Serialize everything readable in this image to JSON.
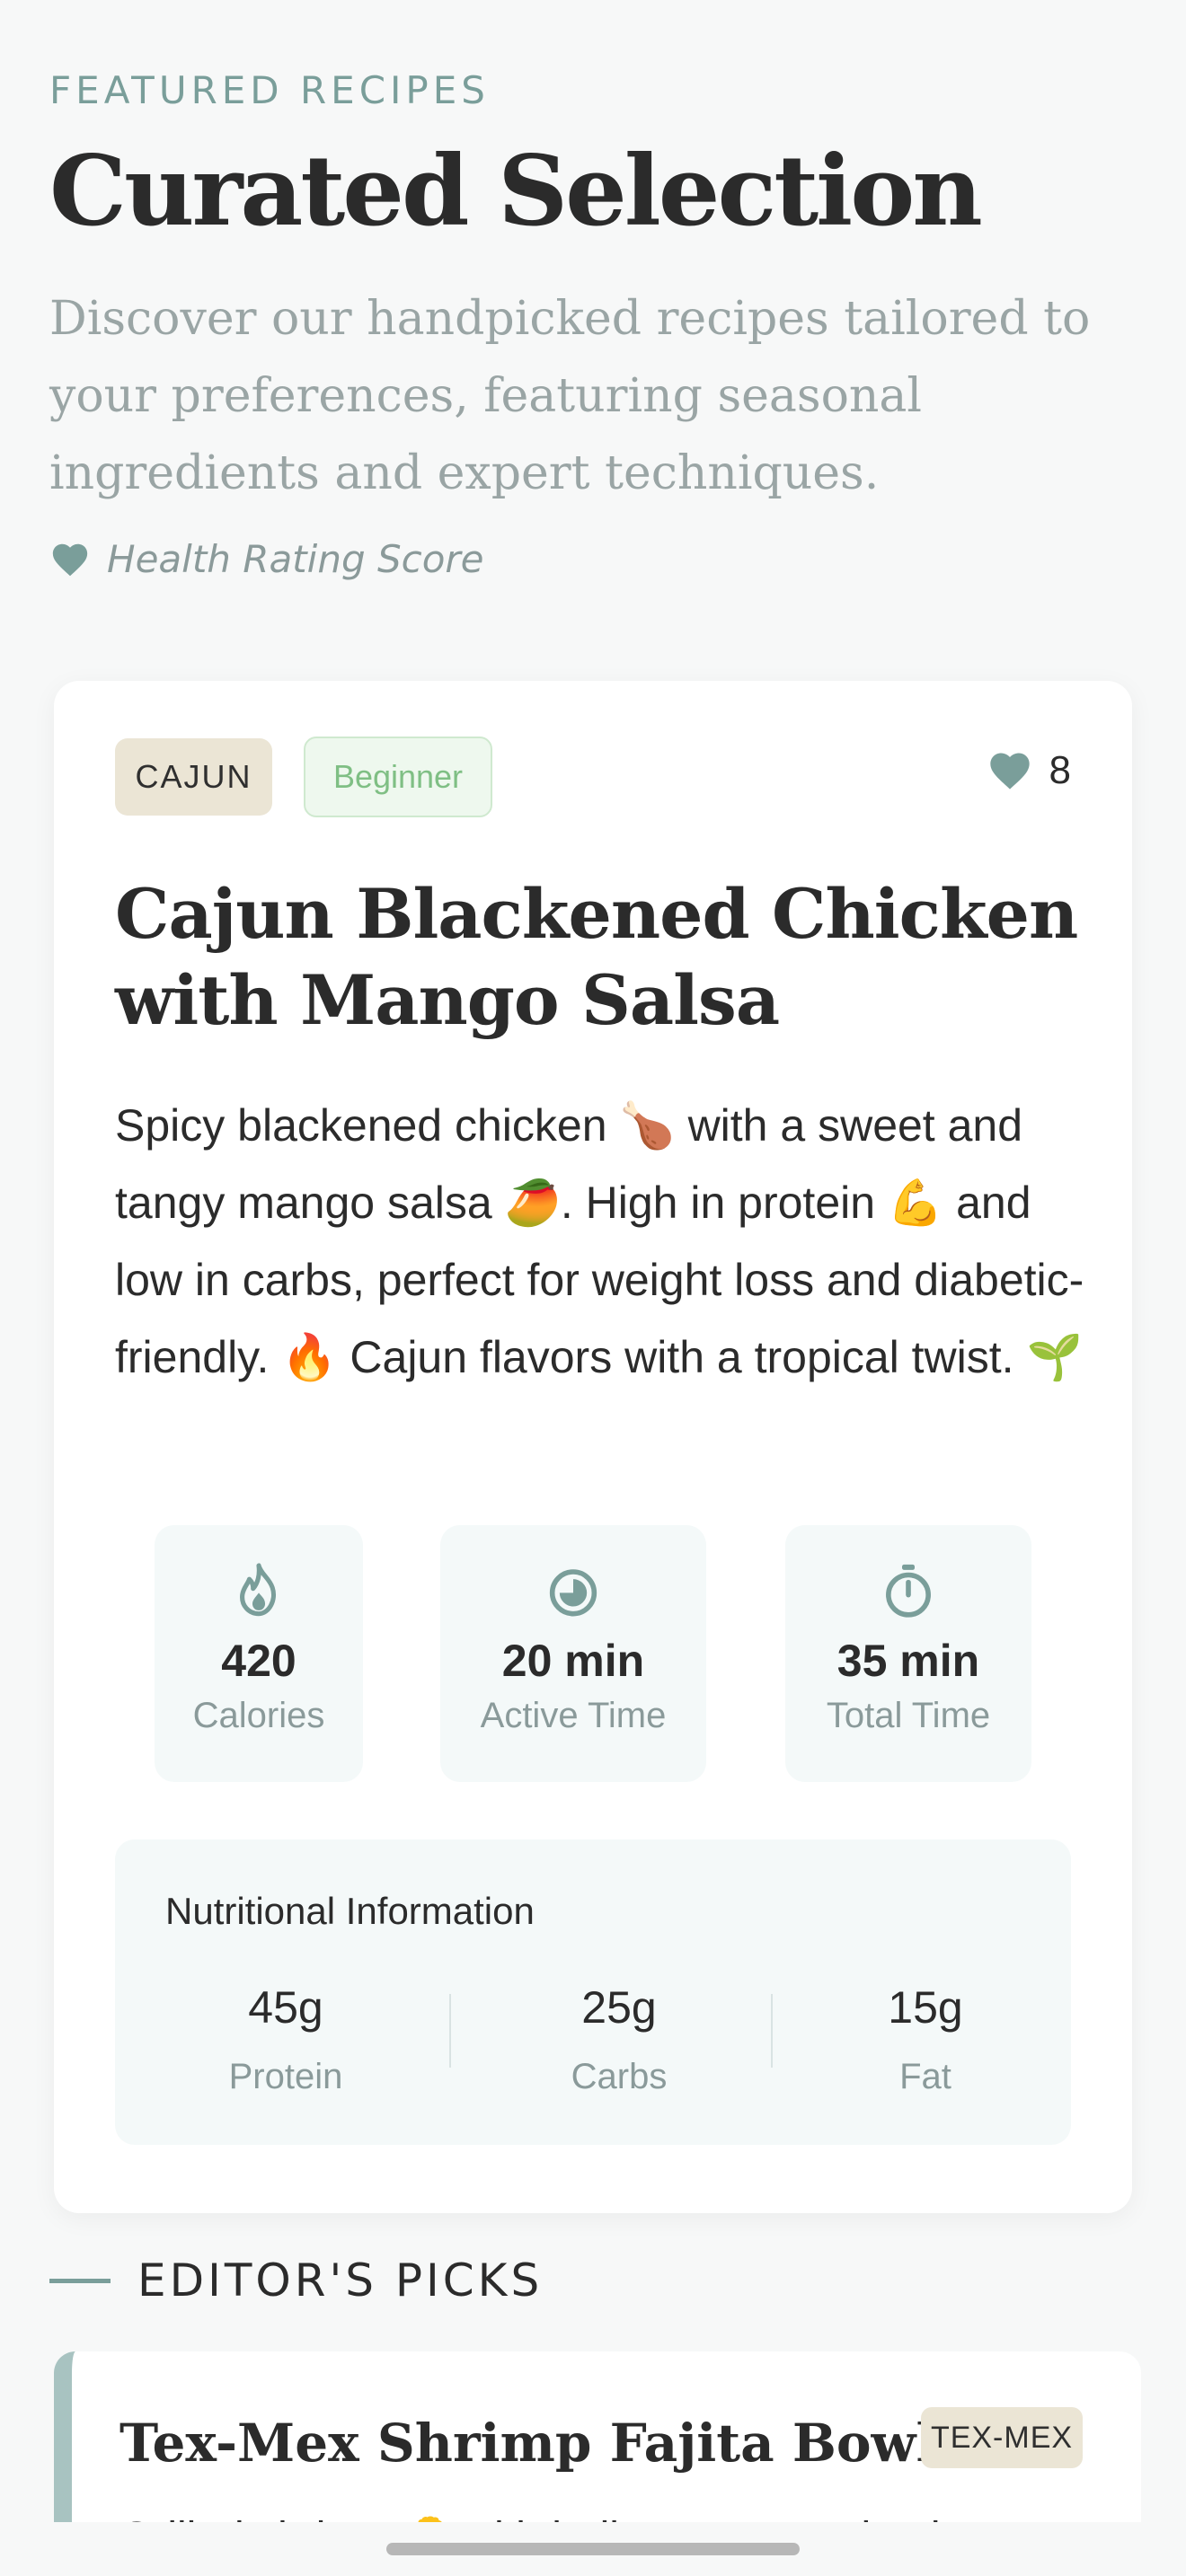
{
  "header": {
    "eyebrow": "FEATURED RECIPES",
    "title": "Curated Selection",
    "intro": "Discover our handpicked recipes tailored to your preferences, featuring seasonal ingredients and expert techniques.",
    "health_label": "Health Rating Score",
    "health_icon": "heart-icon"
  },
  "featured": {
    "cuisine_tag": "CAJUN",
    "level_tag": "Beginner",
    "favorite_count": "8",
    "title": "Cajun Blackened Chicken with Mango Salsa",
    "description": "Spicy blackened chicken 🍗 with a sweet and tangy mango salsa 🥭. High in protein 💪 and low in carbs, perfect for weight loss and diabetic-friendly. 🔥 Cajun flavors with a tropical twist. 🌱",
    "stats": [
      {
        "icon": "flame-icon",
        "value": "420",
        "label": "Calories"
      },
      {
        "icon": "clock-icon",
        "value": "20 min",
        "label": "Active Time"
      },
      {
        "icon": "stopwatch-icon",
        "value": "35 min",
        "label": "Total Time"
      }
    ],
    "nutrition": {
      "title": "Nutritional Information",
      "items": [
        {
          "value": "45g",
          "label": "Protein"
        },
        {
          "value": "25g",
          "label": "Carbs"
        },
        {
          "value": "15g",
          "label": "Fat"
        }
      ]
    }
  },
  "editors_picks": {
    "title": "EDITOR'S PICKS",
    "items": [
      {
        "title": "Tex-Mex Shrimp Fajita Bowl",
        "tag": "TEX-MEX",
        "description": "Grilled shrimp 🍤 with bell peppers and onions served"
      }
    ]
  },
  "colors": {
    "accent": "#7a9e9a",
    "background": "#f7f8f8",
    "tag_beige": "#ebe5d5",
    "beginner_green": "#7fbf84",
    "stat_bg": "#f4f9f9"
  }
}
